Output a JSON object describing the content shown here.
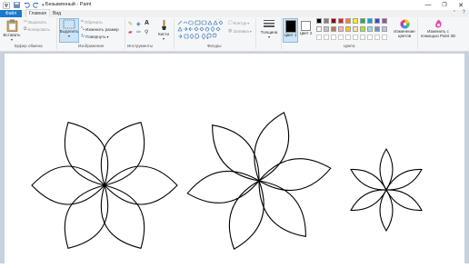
{
  "window": {
    "title": "Безымянный - Paint"
  },
  "menu": {
    "file": "Файл",
    "tabs": [
      "Главная",
      "Вид"
    ]
  },
  "ribbon": {
    "clipboard": {
      "paste": "Вставить",
      "cut": "Вырезать",
      "copy": "Копировать",
      "label": "Буфер обмена"
    },
    "image": {
      "select": "Выделить",
      "crop": "Обрезать",
      "resize": "Изменить размер",
      "rotate": "Повернуть",
      "label": "Изображение"
    },
    "tools": {
      "label": "Инструменты",
      "brushes": "Кисти"
    },
    "shapes": {
      "label": "Фигуры",
      "outline": "Контур",
      "fill": "Заливка"
    },
    "size": {
      "label": "Толщина"
    },
    "colors": {
      "color1": "Цвет 1",
      "color2": "Цвет 2",
      "edit": "Изменение цветов",
      "paint3d": "Изменить с помощью Paint 3D",
      "label": "Цвета",
      "palette_row1": [
        "#000000",
        "#7f7f7f",
        "#880015",
        "#ed1c24",
        "#ff7f27",
        "#fff200",
        "#22b14c",
        "#00a2e8",
        "#3f48cc",
        "#a349a4"
      ],
      "palette_row2": [
        "#ffffff",
        "#c3c3c3",
        "#b97a57",
        "#ffaec9",
        "#ffc90e",
        "#efe4b0",
        "#b5e61d",
        "#99d9ea",
        "#7092be",
        "#c8bfe7"
      ],
      "accent": "#1979ca"
    }
  }
}
